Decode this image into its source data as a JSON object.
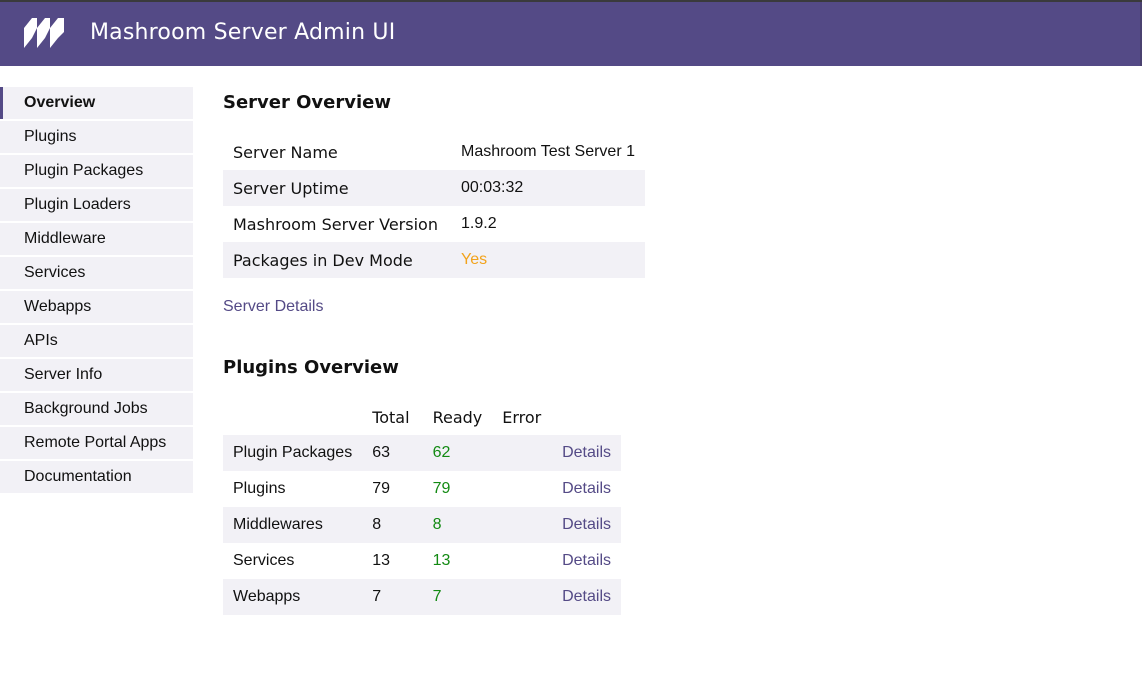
{
  "app": {
    "title": "Mashroom Server Admin UI",
    "logo_icon": "mashroom-logo-icon",
    "brand_color": "#544a86"
  },
  "sidebar": {
    "active": "Overview",
    "items": [
      {
        "label": "Overview",
        "active": true
      },
      {
        "label": "Plugins",
        "active": false
      },
      {
        "label": "Plugin Packages",
        "active": false
      },
      {
        "label": "Plugin Loaders",
        "active": false
      },
      {
        "label": "Middleware",
        "active": false
      },
      {
        "label": "Services",
        "active": false
      },
      {
        "label": "Webapps",
        "active": false
      },
      {
        "label": "APIs",
        "active": false
      },
      {
        "label": "Server Info",
        "active": false
      },
      {
        "label": "Background Jobs",
        "active": false
      },
      {
        "label": "Remote Portal Apps",
        "active": false
      },
      {
        "label": "Documentation",
        "active": false
      }
    ]
  },
  "server_overview": {
    "title": "Server Overview",
    "rows": [
      {
        "label": "Server Name",
        "value": "Mashroom Test Server 1"
      },
      {
        "label": "Server Uptime",
        "value": "00:03:32"
      },
      {
        "label": "Mashroom Server Version",
        "value": "1.9.2"
      },
      {
        "label": "Packages in Dev Mode",
        "value": "Yes",
        "status_color": "#f2a31c"
      }
    ],
    "details_link": "Server Details"
  },
  "plugins_overview": {
    "title": "Plugins Overview",
    "columns": [
      "",
      "Total",
      "Ready",
      "Error",
      ""
    ],
    "rows": [
      {
        "name": "Plugin Packages",
        "total": "63",
        "ready": "62",
        "error": "",
        "link": "Details"
      },
      {
        "name": "Plugins",
        "total": "79",
        "ready": "79",
        "error": "",
        "link": "Details"
      },
      {
        "name": "Middlewares",
        "total": "8",
        "ready": "8",
        "error": "",
        "link": "Details"
      },
      {
        "name": "Services",
        "total": "13",
        "ready": "13",
        "error": "",
        "link": "Details"
      },
      {
        "name": "Webapps",
        "total": "7",
        "ready": "7",
        "error": "",
        "link": "Details"
      }
    ],
    "ready_color": "#138a13"
  }
}
